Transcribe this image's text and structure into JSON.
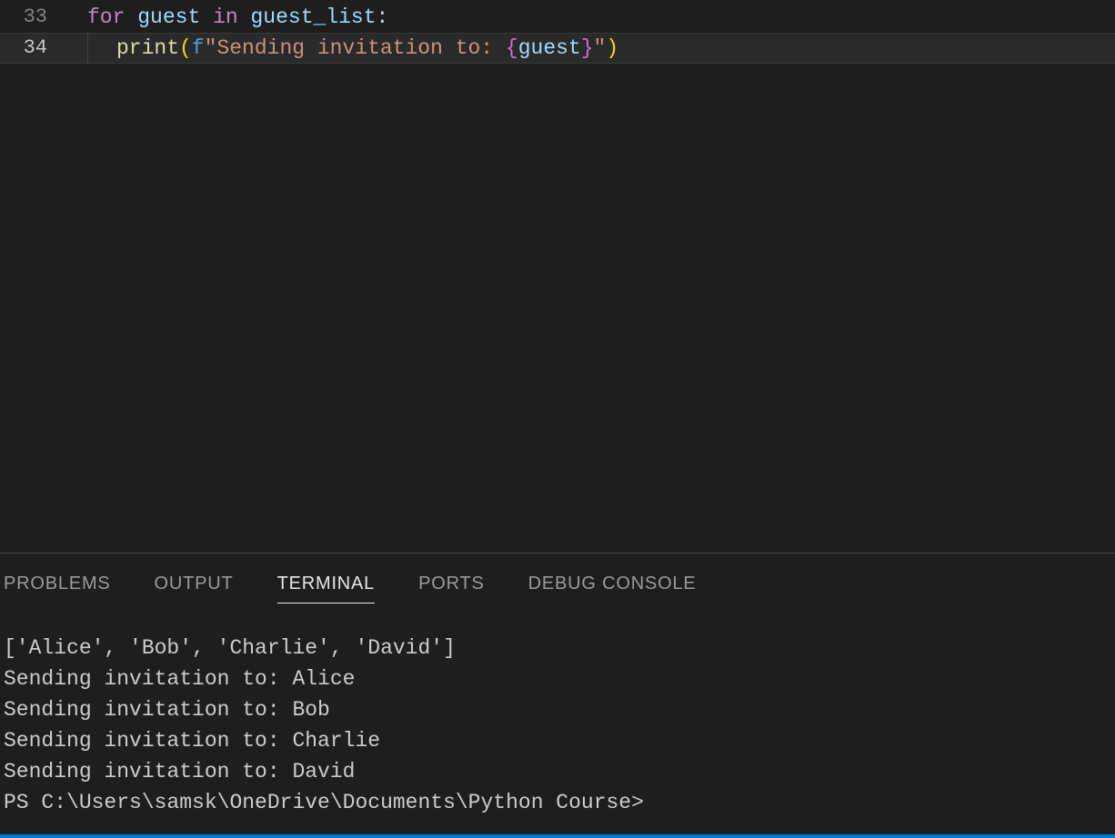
{
  "editor": {
    "lines": [
      {
        "number": "33",
        "active": false,
        "tokens": {
          "for": "for",
          "sp1": " ",
          "var1": "guest",
          "sp2": " ",
          "in": "in",
          "sp3": " ",
          "var2": "guest_list",
          "colon": ":"
        }
      },
      {
        "number": "34",
        "active": true,
        "tokens": {
          "func": "print",
          "lpar": "(",
          "fpfx": "f",
          "q1": "\"",
          "str1": "Sending invitation to: ",
          "lbrace": "{",
          "ivar": "guest",
          "rbrace": "}",
          "q2": "\"",
          "rpar": ")"
        }
      }
    ]
  },
  "panel": {
    "tabs": {
      "problems": "PROBLEMS",
      "output": "OUTPUT",
      "terminal": "TERMINAL",
      "ports": "PORTS",
      "debug_console": "DEBUG CONSOLE"
    },
    "terminal_output": [
      "['Alice', 'Bob', 'Charlie', 'David']",
      "Sending invitation to: Alice",
      "Sending invitation to: Bob",
      "Sending invitation to: Charlie",
      "Sending invitation to: David"
    ],
    "prompt": "PS C:\\Users\\samsk\\OneDrive\\Documents\\Python Course>"
  }
}
